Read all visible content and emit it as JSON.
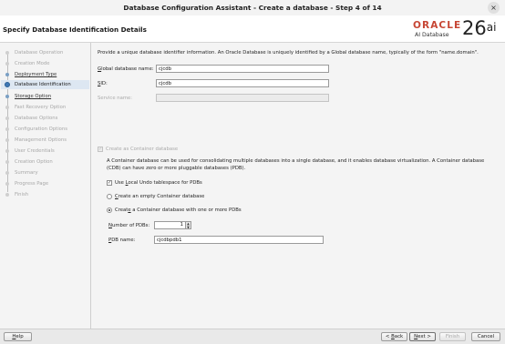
{
  "window": {
    "title": "Database Configuration Assistant - Create a database - Step 4 of 14",
    "close_glyph": "×"
  },
  "header": {
    "page_title": "Specify Database Identification Details",
    "brand": "ORACLE",
    "product": "AI Database",
    "release_number": "26",
    "release_suffix": "ai"
  },
  "sidebar": {
    "steps": [
      {
        "label": "Database Operation",
        "state": "disabled"
      },
      {
        "label": "Creation Mode",
        "state": "disabled"
      },
      {
        "label": "Deployment Type",
        "state": "done"
      },
      {
        "label": "Database Identification",
        "state": "current"
      },
      {
        "label": "Storage Option",
        "state": "next"
      },
      {
        "label": "Fast Recovery Option",
        "state": "disabled"
      },
      {
        "label": "Database Options",
        "state": "disabled"
      },
      {
        "label": "Configuration Options",
        "state": "disabled"
      },
      {
        "label": "Management Options",
        "state": "disabled"
      },
      {
        "label": "User Credentials",
        "state": "disabled"
      },
      {
        "label": "Creation Option",
        "state": "disabled"
      },
      {
        "label": "Summary",
        "state": "disabled"
      },
      {
        "label": "Progress Page",
        "state": "disabled"
      },
      {
        "label": "Finish",
        "state": "disabled"
      }
    ]
  },
  "main": {
    "intro": "Provide a unique database identifier information. An Oracle Database is uniquely identified by a Global database name, typically of the form \"name.domain\".",
    "global_db_name": {
      "label_pre": "G",
      "label_post": "lobal database name:",
      "value": "cjcdb"
    },
    "sid": {
      "label_pre": "S",
      "label_post": "ID:",
      "value": "cjcdb"
    },
    "service_name": {
      "label": "Service name:",
      "value": ""
    },
    "container_db": {
      "label": "Create as Container database",
      "checked": true,
      "enabled": false
    },
    "container_desc": "A Container database can be used for consolidating multiple databases into a single database, and it enables database virtualization. A Container database (CDB) can have zero or more pluggable databases (PDB).",
    "local_undo": {
      "label_pre": "Use ",
      "label_u": "L",
      "label_post": "ocal Undo tablespace for PDBs",
      "checked": true
    },
    "empty_container": {
      "label_pre": "C",
      "label_post": "reate an empty Container database",
      "selected": false
    },
    "with_pdbs": {
      "label_pre": "Creat",
      "label_u": "e",
      "label_post": " a Container database with one or more PDBs",
      "selected": true
    },
    "num_pdbs": {
      "label_pre": "N",
      "label_post": "umber of PDBs:",
      "value": "1",
      "up": "▲",
      "down": "▼"
    },
    "pdb_name": {
      "label_pre": "P",
      "label_post": "DB name:",
      "value": "cjcdbpdb1"
    }
  },
  "footer": {
    "help": {
      "u": "H",
      "rest": "elp"
    },
    "back": {
      "pre": "< ",
      "u": "B",
      "rest": "ack"
    },
    "next": {
      "u": "N",
      "rest": "ext >"
    },
    "finish": {
      "label": "Finish"
    },
    "cancel": {
      "label": "Cancel"
    }
  },
  "colors": {
    "oracle_red": "#c74634",
    "current_step_bg": "#dde7f2"
  }
}
